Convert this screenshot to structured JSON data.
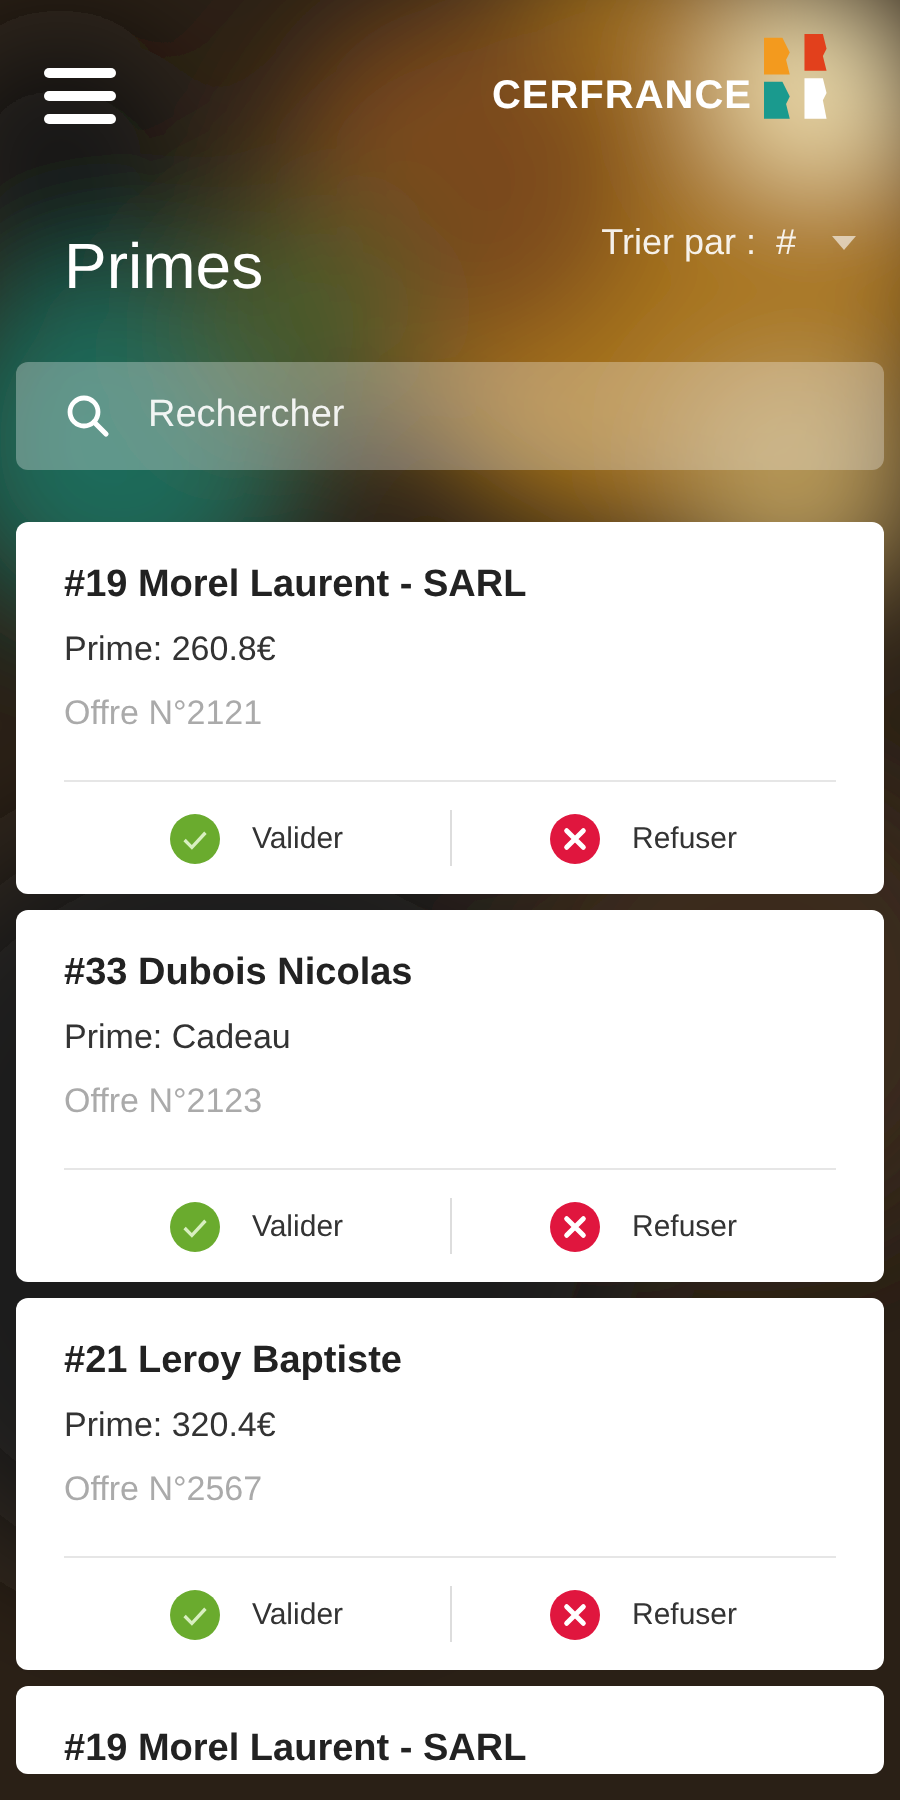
{
  "header": {
    "logo_text": "CERFRANCE"
  },
  "title": "Primes",
  "sort": {
    "label": "Trier par :",
    "value": "#"
  },
  "search": {
    "placeholder": "Rechercher"
  },
  "cards": [
    {
      "name": "#19 Morel Laurent - SARL",
      "prime": "Prime: 260.8€",
      "offer": "Offre N°2121",
      "actions": [
        {
          "kind": "accept",
          "label": "Valider"
        },
        {
          "kind": "refuse",
          "label": "Refuser"
        }
      ]
    },
    {
      "name": "#33 Dubois Nicolas",
      "prime": "Prime: Cadeau",
      "offer": "Offre N°2123",
      "actions": [
        {
          "kind": "accept",
          "label": "Valider"
        },
        {
          "kind": "refuse",
          "label": "Refuser"
        }
      ]
    },
    {
      "name": "#21 Leroy Baptiste",
      "prime": "Prime: 320.4€",
      "offer": "Offre N°2567",
      "actions": [
        {
          "kind": "accept",
          "label": "Valider"
        },
        {
          "kind": "refuse",
          "label": "Refuser"
        }
      ]
    },
    {
      "name": "#19 Morel Laurent - SARL"
    }
  ]
}
